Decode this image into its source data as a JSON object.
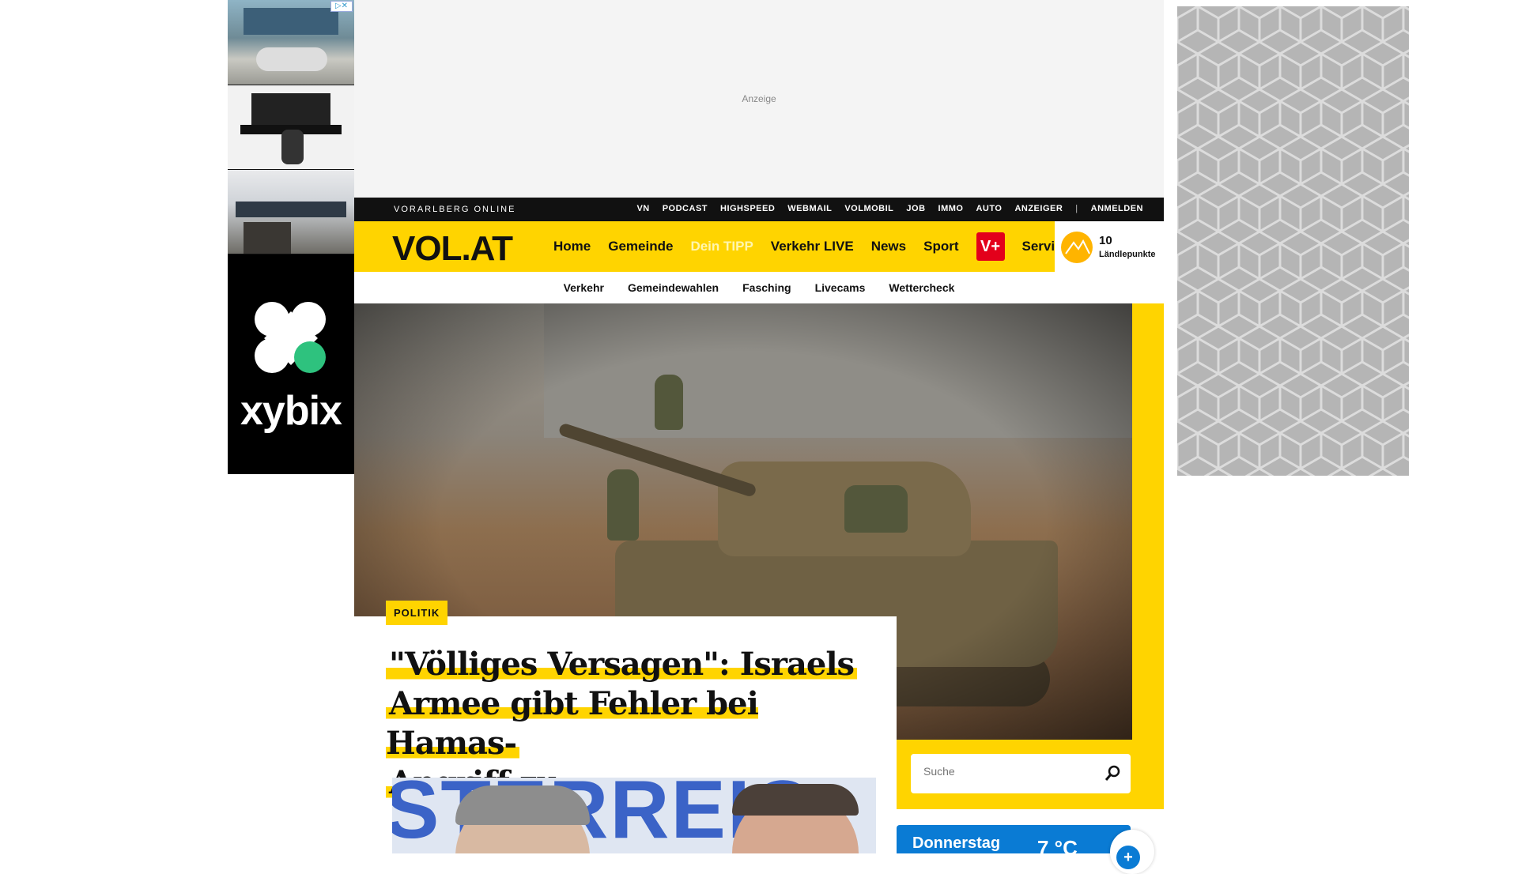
{
  "ads": {
    "top_label": "Anzeige",
    "left_brand": "xybix"
  },
  "topbar": {
    "brand": "VORARLBERG ONLINE",
    "links": [
      "VN",
      "PODCAST",
      "HIGHSPEED",
      "WEBMAIL",
      "VOLMOBIL",
      "JOB",
      "IMMO",
      "AUTO",
      "ANZEIGER"
    ],
    "login": "ANMELDEN"
  },
  "mainnav": {
    "logo": "VOL.AT",
    "items": [
      "Home",
      "Gemeinde",
      "Dein TIPP",
      "Verkehr LIVE",
      "News",
      "Sport"
    ],
    "vplus": "V+",
    "service": "Service",
    "points_value": "10",
    "points_label": "Ländlepunkte"
  },
  "subnav": [
    "Verkehr",
    "Gemeindewahlen",
    "Fasching",
    "Livecams",
    "Wettercheck"
  ],
  "article": {
    "category": "POLITIK",
    "headline_lines": [
      "\"Völliges Versagen\": Israels",
      "Armee gibt Fehler bei Hamas-",
      "Angriff zu"
    ]
  },
  "second_image_text": "STERREIC",
  "search": {
    "placeholder": "Suche"
  },
  "weather": {
    "day": "Donnerstag",
    "temp": "7 °C"
  },
  "colors": {
    "brand_yellow": "#ffd400",
    "topbar_black": "#111111",
    "vplus_red": "#e3001b",
    "weather_blue": "#0a7bd4"
  }
}
